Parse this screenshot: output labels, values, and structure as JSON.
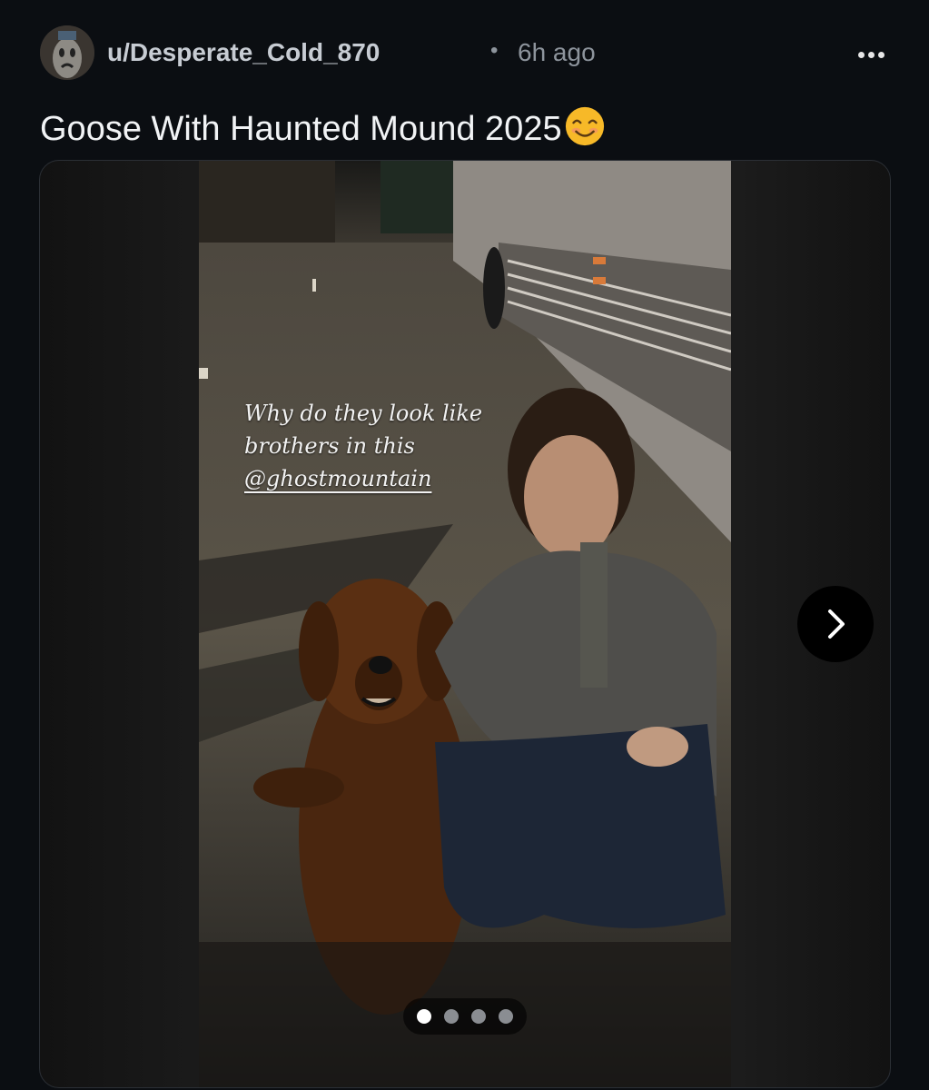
{
  "post": {
    "username": "u/Desperate_Cold_870",
    "separator": "•",
    "time_ago": "6h ago",
    "title": "Goose With Haunted Mound 2025"
  },
  "media": {
    "overlay_lines": [
      "Why do they look like",
      "brothers in this"
    ],
    "overlay_tag": "@ghostmountain",
    "page_count": 4,
    "active_page": 1
  },
  "icons": {
    "avatar": "avatar-icon",
    "more": "more-horizontal-icon",
    "emoji": "smiling-face-emoji-icon",
    "next": "chevron-right-icon"
  },
  "colors": {
    "background": "#0b0e12",
    "username": "#c7ccd3",
    "meta": "#8d949c",
    "title": "#f1f3f5"
  }
}
